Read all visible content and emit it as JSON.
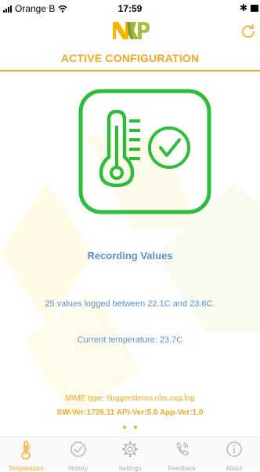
{
  "status_bar": {
    "carrier": "Orange B",
    "time": "17:59",
    "bluetooth": "✱"
  },
  "header": {
    "logo_text": "NXP",
    "reload_icon": "reload-icon"
  },
  "title": "ACTIVE CONFIGURATION",
  "main": {
    "status": "Recording Values",
    "summary": "25 values logged between  22.1C and  23.6C.",
    "current_temperature": "Current temperature:  23.7C",
    "mime_type": "MIME type: tlogger/demo.nhs.nxp.log",
    "versions": "SW-Ver:1726.11  API-Ver:5.0  App-Ver:1.0"
  },
  "pager": {
    "count": 2
  },
  "tabs": [
    {
      "label": "Temperature",
      "icon": "thermometer-icon",
      "active": true
    },
    {
      "label": "History",
      "icon": "clock-icon",
      "active": false
    },
    {
      "label": "Settings",
      "icon": "gear-icon",
      "active": false
    },
    {
      "label": "Feedback",
      "icon": "phone-icon",
      "active": false
    },
    {
      "label": "About",
      "icon": "info-icon",
      "active": false
    }
  ],
  "colors": {
    "accent": "#f5a623",
    "text_blue": "#5b8fd6",
    "green": "#2dbd3a"
  }
}
